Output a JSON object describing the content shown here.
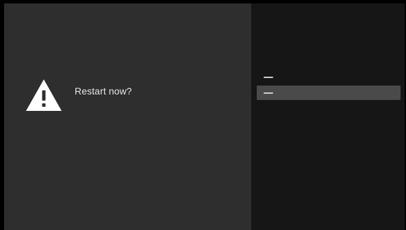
{
  "dialog": {
    "prompt": "Restart now?",
    "icon": "warning-icon"
  },
  "options": [
    {
      "label": "—"
    },
    {
      "label": "—"
    }
  ],
  "colors": {
    "left_pane": "#2e2e2e",
    "right_pane": "#161616",
    "selected_option": "#4a4a4a",
    "text": "#e8e8e8"
  }
}
